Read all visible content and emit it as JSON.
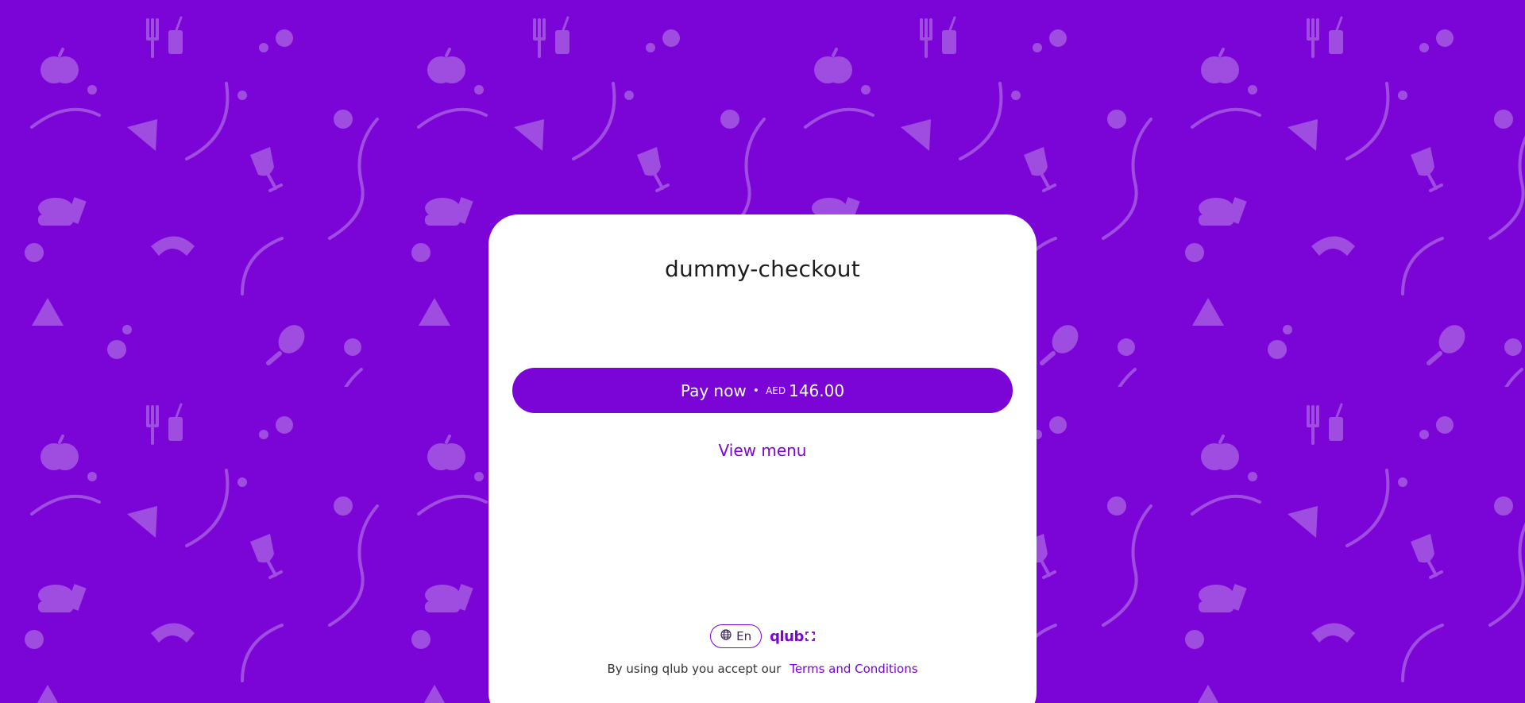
{
  "page": {
    "background_color": "#7b04d6",
    "accent_color": "#7b04d6"
  },
  "checkout": {
    "title": "dummy-checkout",
    "pay_button": {
      "label": "Pay now",
      "separator": "•",
      "currency": "AED",
      "amount": "146.00"
    },
    "view_menu_label": "View menu"
  },
  "footer": {
    "language_label": "En",
    "language_icon": "globe-icon",
    "logo_text": "qlub",
    "terms_prefix": "By using qlub you accept our",
    "terms_link": "Terms and Conditions"
  }
}
